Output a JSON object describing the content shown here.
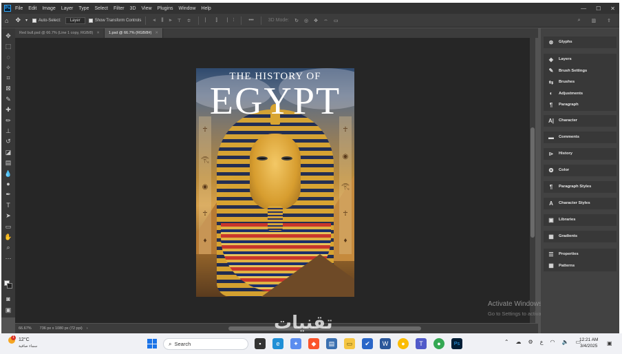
{
  "app": {
    "logo": "Ps",
    "menu": [
      "File",
      "Edit",
      "Image",
      "Layer",
      "Type",
      "Select",
      "Filter",
      "3D",
      "View",
      "Plugins",
      "Window",
      "Help"
    ]
  },
  "options_bar": {
    "auto_select_label": "Auto-Select:",
    "auto_select_value": "Layer",
    "transform_controls_label": "Show Transform Controls",
    "mode_label": "3D Mode:"
  },
  "tabs": [
    {
      "label": "Red bull.psd @ 66.7% (Line 1 copy, RGB/8)",
      "active": false
    },
    {
      "label": "1.psd @ 66.7% (RGB/8#)",
      "active": true
    }
  ],
  "document": {
    "subtitle": "THE HISTORY OF",
    "title": "EGYPT"
  },
  "status": {
    "zoom": "66.67%",
    "doc_info": "736 px x 1080 px (72 ppi)"
  },
  "watermark": {
    "line1": "Activate Windows",
    "line2": "Go to Settings to activate Windows."
  },
  "panels": {
    "group1": [
      {
        "icon": "glyphs-icon",
        "label": "Glyphs"
      }
    ],
    "group2": [
      {
        "icon": "layers-icon",
        "label": "Layers"
      },
      {
        "icon": "brush-settings-icon",
        "label": "Brush Settings"
      },
      {
        "icon": "brushes-icon",
        "label": "Brushes"
      },
      {
        "icon": "adjustments-icon",
        "label": "Adjustments"
      },
      {
        "icon": "paragraph-icon",
        "label": "Paragraph"
      }
    ],
    "group3": [
      {
        "icon": "character-icon",
        "label": "Character"
      }
    ],
    "group4": [
      {
        "icon": "comments-icon",
        "label": "Comments"
      }
    ],
    "group5": [
      {
        "icon": "history-icon",
        "label": "History"
      }
    ],
    "group6": [
      {
        "icon": "color-icon",
        "label": "Color"
      }
    ],
    "group7": [
      {
        "icon": "paragraph-styles-icon",
        "label": "Paragraph Styles"
      }
    ],
    "group8": [
      {
        "icon": "character-styles-icon",
        "label": "Character Styles"
      }
    ],
    "group9": [
      {
        "icon": "libraries-icon",
        "label": "Libraries"
      }
    ],
    "group10": [
      {
        "icon": "gradients-icon",
        "label": "Gradients"
      }
    ],
    "group11": [
      {
        "icon": "properties-icon",
        "label": "Properties"
      },
      {
        "icon": "patterns-icon",
        "label": "Patterns"
      }
    ]
  },
  "taskbar": {
    "weather_temp": "12°C",
    "weather_desc": "سماء صافية",
    "weather_badge": "1",
    "search_label": "Search",
    "time": "12:21 AM",
    "date": "3/4/2025",
    "site_watermark": "تقنيات"
  },
  "colors": {
    "ps_accent": "#31a8ff",
    "workspace": "#535353",
    "canvas_bg": "#262626"
  }
}
